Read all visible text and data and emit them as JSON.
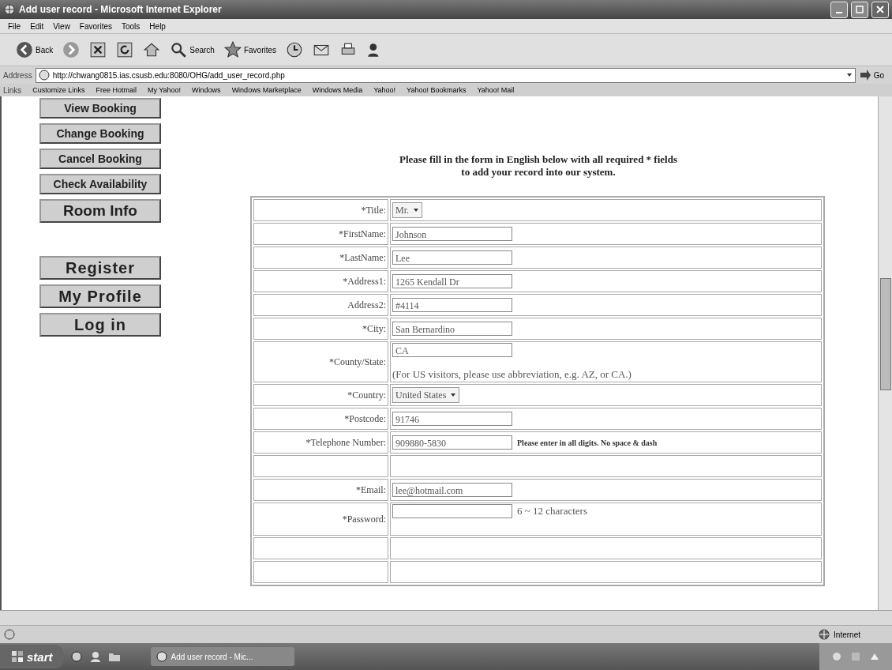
{
  "window": {
    "title": "Add user record - Microsoft Internet Explorer"
  },
  "menu": [
    "File",
    "Edit",
    "View",
    "Favorites",
    "Tools",
    "Help"
  ],
  "toolbar": {
    "back": "Back",
    "search": "Search",
    "favorites": "Favorites"
  },
  "address": {
    "label": "Address",
    "url": "http://chwang0815.ias.csusb.edu:8080/OHG/add_user_record.php",
    "go": "Go"
  },
  "links": {
    "label": "Links",
    "items": [
      "Customize Links",
      "Free Hotmail",
      "My Yahoo!",
      "Windows",
      "Windows Marketplace",
      "Windows Media",
      "Yahoo!",
      "Yahoo! Bookmarks",
      "Yahoo! Mail"
    ]
  },
  "nav_groups": [
    [
      {
        "label": "View Booking",
        "kind": "small"
      },
      {
        "label": "Change Booking",
        "kind": "small"
      },
      {
        "label": "Cancel Booking",
        "kind": "small"
      },
      {
        "label": "Check Availability",
        "kind": "small"
      },
      {
        "label": "Room Info",
        "kind": "medium"
      }
    ],
    [
      {
        "label": "Register",
        "kind": "large"
      },
      {
        "label": "My Profile",
        "kind": "large"
      },
      {
        "label": "Log in",
        "kind": "large"
      }
    ]
  ],
  "form": {
    "intro": [
      "Please fill in the form in English below with all required * fields",
      "to add your record into our system."
    ],
    "rows": [
      {
        "label": "*Title:",
        "kind": "select",
        "value": "Mr."
      },
      {
        "label": "*FirstName:",
        "kind": "text",
        "value": "Johnson"
      },
      {
        "label": "*LastName:",
        "kind": "text",
        "value": "Lee"
      },
      {
        "label": "*Address1:",
        "kind": "text",
        "value": "1265 Kendall Dr"
      },
      {
        "label": "Address2:",
        "kind": "text",
        "value": "#4114"
      },
      {
        "label": "*City:",
        "kind": "text",
        "value": "San Bernardino"
      },
      {
        "label": "*County/State:",
        "kind": "state",
        "value": "CA",
        "note": "(For US visitors, please use abbreviation, e.g. AZ, or CA.)"
      },
      {
        "label": "*Country:",
        "kind": "select",
        "value": "United States"
      },
      {
        "label": "*Postcode:",
        "kind": "text",
        "value": "91746"
      },
      {
        "label": "*Telephone Number:",
        "kind": "text",
        "value": "909880-5830",
        "note": "Please enter in all digits. No space & dash"
      },
      {
        "kind": "blank"
      },
      {
        "label": "*Email:",
        "kind": "text",
        "value": "lee@hotmail.com"
      },
      {
        "label": "*Password:",
        "kind": "password",
        "note": "6 ~ 12 characters"
      },
      {
        "kind": "blank"
      },
      {
        "kind": "blank"
      }
    ]
  },
  "status_bar": {
    "zone": "Internet"
  },
  "taskbar": {
    "start": "start",
    "tasks": [
      "Add user record - Mic..."
    ]
  }
}
